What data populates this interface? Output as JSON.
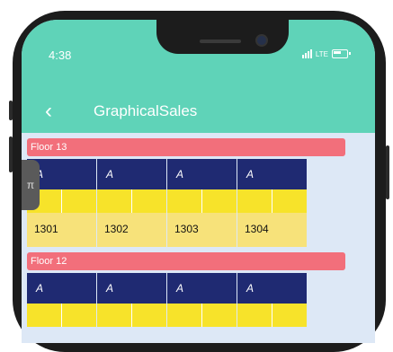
{
  "status": {
    "time": "4:38",
    "network": "LTE"
  },
  "appbar": {
    "title": "GraphicalSales",
    "back_icon": "chevron-left-icon"
  },
  "floors": [
    {
      "label": "Floor 13",
      "units": [
        {
          "type": "A",
          "number": "1301"
        },
        {
          "type": "A",
          "number": "1302"
        },
        {
          "type": "A",
          "number": "1303"
        },
        {
          "type": "A",
          "number": "1304"
        }
      ]
    },
    {
      "label": "Floor 12",
      "units": [
        {
          "type": "A",
          "number": ""
        },
        {
          "type": "A",
          "number": ""
        },
        {
          "type": "A",
          "number": ""
        },
        {
          "type": "A",
          "number": ""
        }
      ]
    }
  ],
  "side_tab": {
    "label": "π"
  },
  "colors": {
    "accent": "#5fd3b8",
    "floor_header": "#f26f7b",
    "unit_type_bg": "#1f2a72",
    "unit_yellow": "#f7e32a",
    "unit_label_bg": "#f7e27a"
  }
}
